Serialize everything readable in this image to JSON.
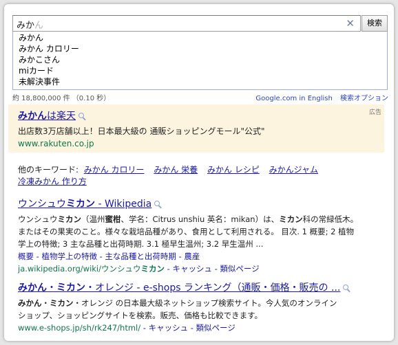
{
  "search": {
    "query_committed": "みか",
    "query_pending": "ん",
    "clear_glyph": "✕",
    "button_label": "検索"
  },
  "suggestions": [
    "みかん",
    "みかん カロリー",
    "みかこさん",
    "miカード",
    "未解決事件"
  ],
  "stats": "約 18,800,000 件 （0.10 秒）",
  "toplinks": [
    "Google.com in English",
    "検索オプション"
  ],
  "ad": {
    "label": "広告",
    "title_bold": "みかん",
    "title_rest": "は楽天",
    "description": "出店数3万店舗以上！日本最大級の 通販ショッピングモール\"公式\"",
    "url": "www.rakuten.co.jp"
  },
  "related": {
    "label": "他のキーワード:",
    "links": [
      "みかん カロリー",
      "みかん 栄養",
      "みかん レシピ",
      "みかんジャム",
      "冷凍みかん 作り方"
    ]
  },
  "results": [
    {
      "title_pre": "ウンシュウ",
      "title_bold": "ミカン",
      "title_post": " - Wikipedia",
      "snippet_lines": [
        [
          "ウンシュウ",
          "ミカン",
          "（温州",
          "蜜柑",
          "、学名：Citrus unshiu 英名：mikan）は、",
          "ミカン",
          "科の常緑低木。"
        ],
        [
          "またはその果実のこと。様々な栽培品種があり、食用として利用される。 目次. 1 概要; 2 植物"
        ],
        [
          "学上の特徴; 3 主な品種と出荷時期. 3.1 極早生温州; 3.2 早生温州 ..."
        ]
      ],
      "sublinks": "概要 - 植物学上の特徴 - 主な品種と出荷時期 - 農産",
      "url_pre": "ja.wikipedia.org/wiki/ウンシュウ",
      "url_bold": "ミカン",
      "url_actions": " - キャッシュ - 類似ページ"
    },
    {
      "title_bold1": "みかん",
      "title_mid": "・",
      "title_bold2": "ミカン",
      "title_post": "・オレンジ - e-shops ランキング（通販・価格・販売の ...",
      "snippet_lines": [
        [
          "みかん",
          "・",
          "ミカン",
          "・オレンジ の日本最大級ネットショップ検索サイト。今人気のオンライン"
        ],
        [
          "ショップ、ショッピングサイトを検索。販売、価格も比較できます。"
        ]
      ],
      "url": "www.e-shops.jp/sh/rk247/html/",
      "url_actions": " - キャッシュ - 類似ページ"
    }
  ]
}
